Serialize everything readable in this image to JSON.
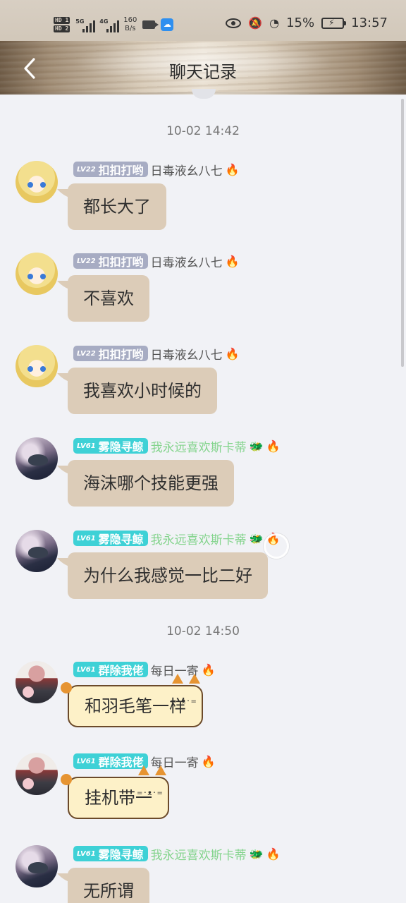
{
  "status_bar": {
    "hd1": "HD 1",
    "hd2": "HD 2",
    "network1": "5G",
    "network2": "4G",
    "speed_value": "160",
    "speed_unit": "B/s",
    "battery": "15%",
    "time": "13:57"
  },
  "header": {
    "title": "聊天记录"
  },
  "timestamps": [
    "10-02 14:42",
    "10-02 14:50"
  ],
  "messages": [
    {
      "level": "LV22",
      "name": "扣扣打哟",
      "tag": "日毒液幺八七",
      "text": "都长大了"
    },
    {
      "level": "LV22",
      "name": "扣扣打哟",
      "tag": "日毒液幺八七",
      "text": "不喜欢"
    },
    {
      "level": "LV22",
      "name": "扣扣打哟",
      "tag": "日毒液幺八七",
      "text": "我喜欢小时候的"
    },
    {
      "level": "LV61",
      "name": "雾隐寻鲸",
      "tag": "我永远喜欢斯卡蒂",
      "text": "海沫哪个技能更强"
    },
    {
      "level": "LV61",
      "name": "雾隐寻鲸",
      "tag": "我永远喜欢斯卡蒂",
      "text": "为什么我感觉一比二好"
    },
    {
      "level": "LV61",
      "name": "群除我佬",
      "tag": "每日一寄",
      "text": "和羽毛笔一样"
    },
    {
      "level": "LV61",
      "name": "群除我佬",
      "tag": "每日一寄",
      "text": "挂机带一"
    },
    {
      "level": "LV61",
      "name": "雾隐寻鲸",
      "tag": "我永远喜欢斯卡蒂",
      "text": "无所谓"
    }
  ],
  "icons": {
    "fire": "🔥",
    "horse": "🐲",
    "cat_face": "=･ᴥ･="
  }
}
